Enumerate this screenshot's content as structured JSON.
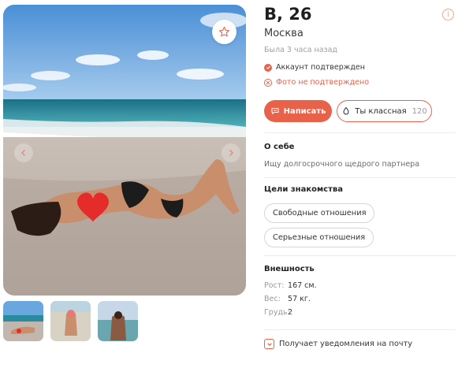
{
  "profile": {
    "name_age": "В, 26",
    "city": "Москва",
    "last_seen": "Была 3 часа назад",
    "account_verified": "Аккаунт подтвержден",
    "photo_not_verified": "Фото не подтверждено"
  },
  "actions": {
    "write_label": "Написать",
    "like_label": "Ты классная",
    "like_count": "120"
  },
  "about": {
    "title": "О себе",
    "text": "Ищу долгосрочного щедрого партнера"
  },
  "goals": {
    "title": "Цели знакомства",
    "items": [
      "Свободные отношения",
      "Серьезные отношения"
    ]
  },
  "appearance": {
    "title": "Внешность",
    "height_label": "Рост:",
    "height_value": "167 см.",
    "weight_label": "Вес:",
    "weight_value": "57 кг.",
    "chest_label": "Грудь:",
    "chest_value": "2"
  },
  "notify": {
    "label": "Получает уведомления на почту"
  },
  "colors": {
    "accent": "#e8624a",
    "muted": "#a0a0a0"
  },
  "icons": [
    "star-icon",
    "info-icon",
    "check-icon",
    "cross-icon",
    "chat-icon",
    "drop-icon",
    "chevron-down-icon",
    "arrow-left-icon",
    "arrow-right-icon"
  ]
}
